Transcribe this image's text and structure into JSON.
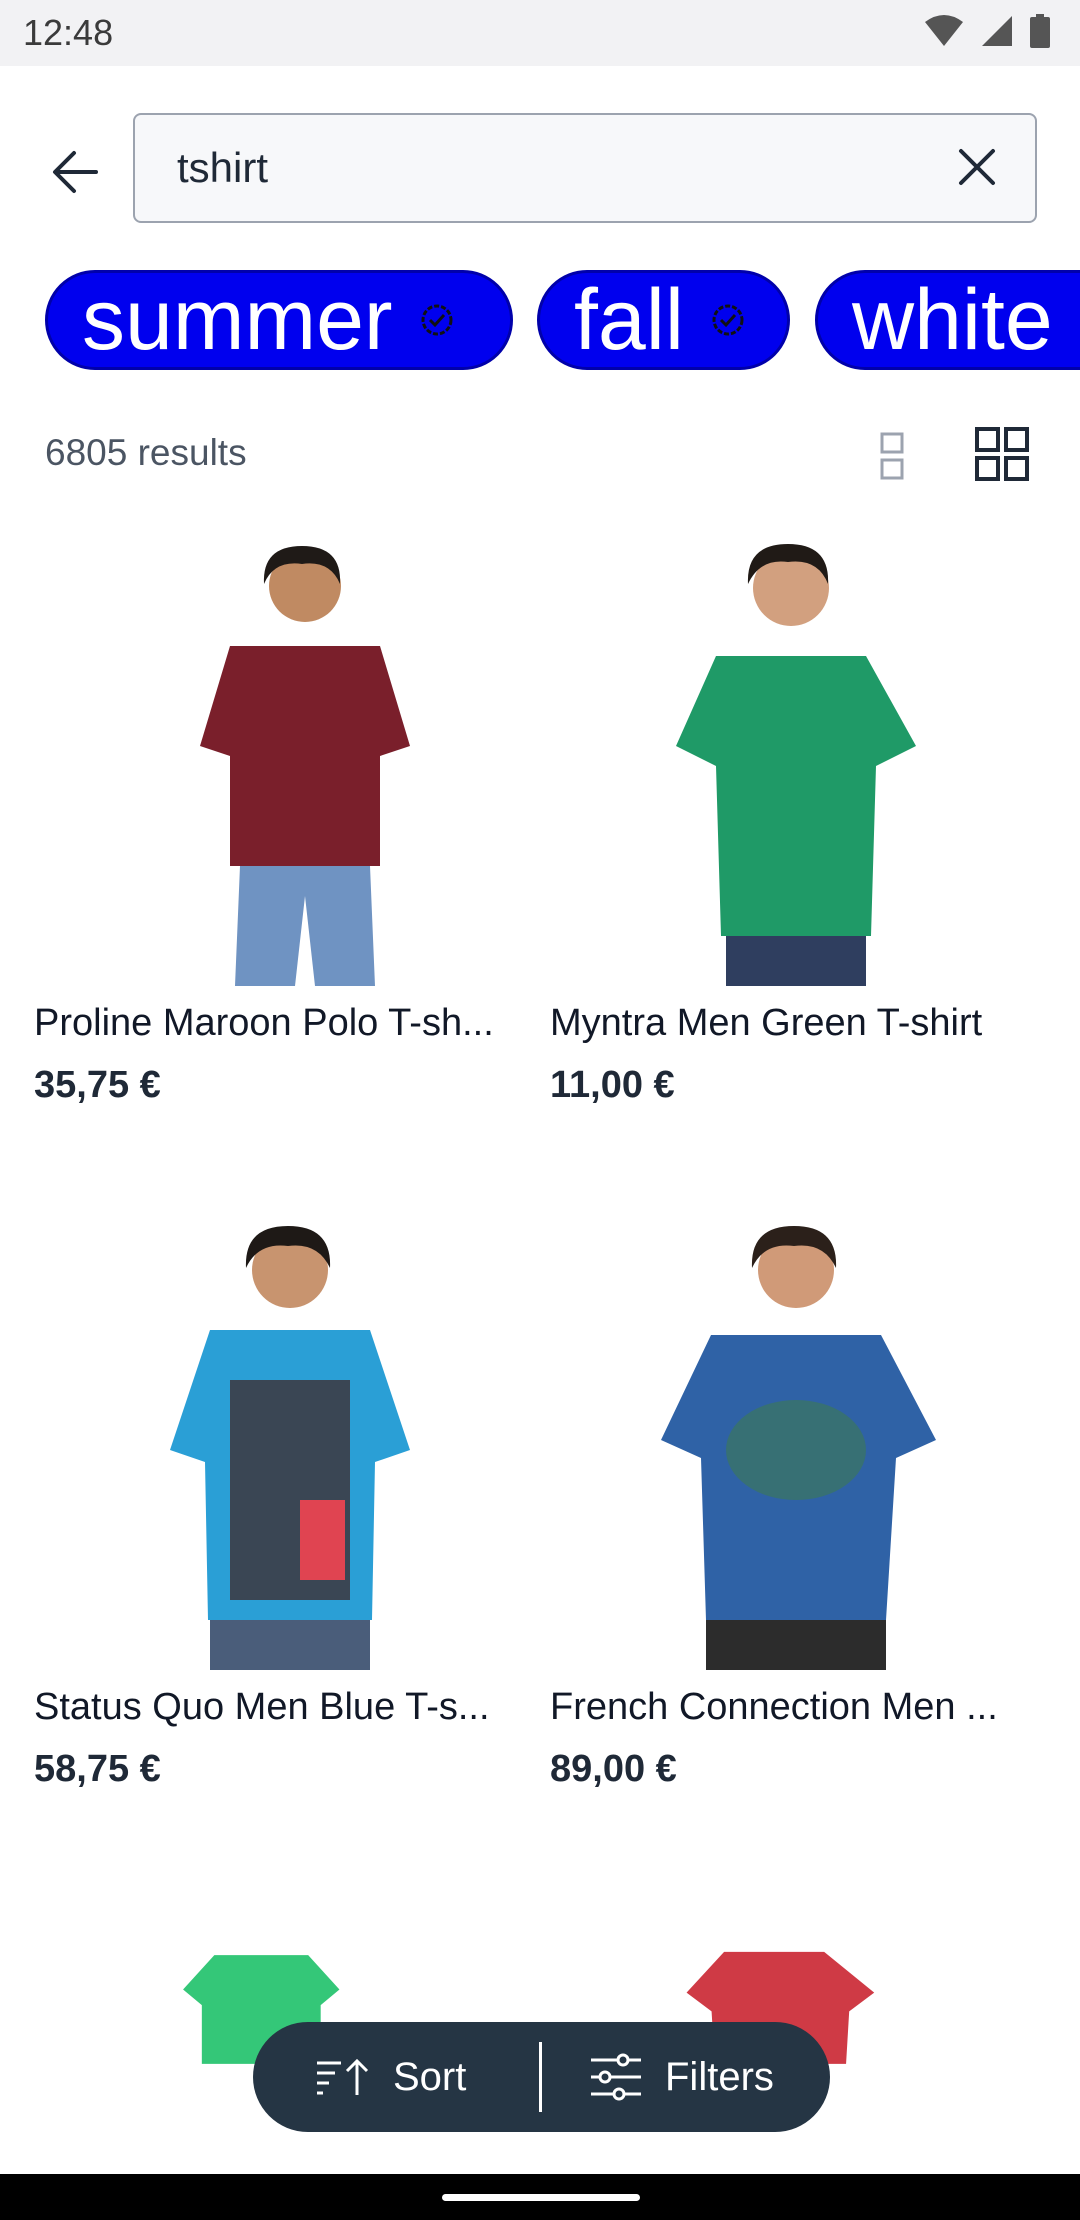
{
  "status_bar": {
    "time": "12:48",
    "icons": [
      "wifi-icon",
      "signal-icon",
      "battery-icon"
    ]
  },
  "search": {
    "value": "tshirt",
    "back_icon": "arrow-left-icon",
    "clear_icon": "close-icon"
  },
  "chips": [
    {
      "label": "summer",
      "icon": "verified-badge-icon"
    },
    {
      "label": "fall",
      "icon": "verified-badge-icon"
    },
    {
      "label": "white",
      "icon": "verified-badge-icon"
    }
  ],
  "results": {
    "count_text": "6805 results",
    "view_single_icon": "single-column-view-icon",
    "view_grid_icon": "grid-view-icon"
  },
  "products": [
    {
      "name": "Proline Maroon Polo T-sh...",
      "price": "35,75 €",
      "shirt_color": "#7a1f2b"
    },
    {
      "name": "Myntra Men Green T-shirt",
      "price": "11,00 €",
      "shirt_color": "#1f9a67"
    },
    {
      "name": "Status Quo Men Blue T-s...",
      "price": "58,75 €",
      "shirt_color": "#2a9fd6"
    },
    {
      "name": "French Connection Men ...",
      "price": "89,00 €",
      "shirt_color": "#2f62a6"
    },
    {
      "name": "",
      "price": "",
      "shirt_color": "#34c778"
    },
    {
      "name": "",
      "price": "",
      "shirt_color": "#cf3a45"
    }
  ],
  "bottom_bar": {
    "sort_label": "Sort",
    "filters_label": "Filters"
  },
  "colors": {
    "chip_bg": "#0000ee",
    "bar_bg": "#253544"
  }
}
